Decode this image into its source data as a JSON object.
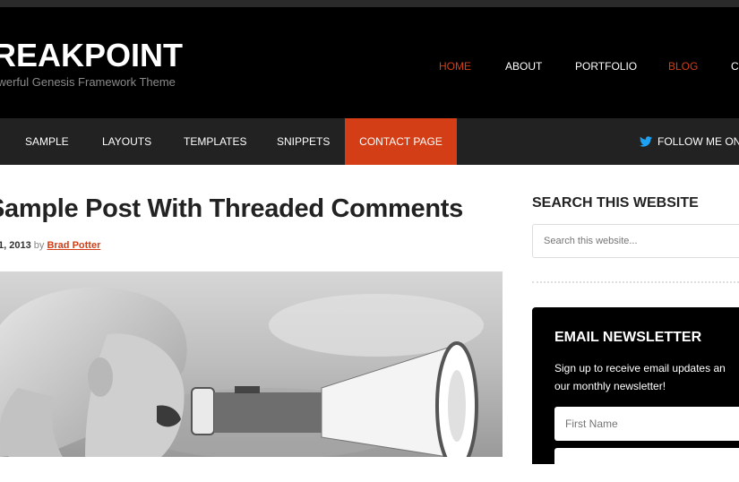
{
  "header": {
    "site_title": "BREAKPOINT",
    "tagline": "A Powerful Genesis Framework Theme",
    "nav": [
      {
        "label": "HOME",
        "active": true
      },
      {
        "label": "ABOUT",
        "active": false
      },
      {
        "label": "PORTFOLIO",
        "active": false
      },
      {
        "label": "BLOG",
        "active": true
      },
      {
        "label": "C",
        "active": false
      }
    ]
  },
  "subnav": {
    "items": [
      "SAMPLE",
      "LAYOUTS",
      "TEMPLATES",
      "SNIPPETS"
    ],
    "contact": "CONTACT PAGE",
    "follow": "FOLLOW ME ON"
  },
  "post": {
    "title": "Sample Post With Threaded Comments",
    "date": "1, 2013",
    "by": "by",
    "author": "Brad Potter"
  },
  "sidebar": {
    "search_title": "SEARCH THIS WEBSITE",
    "search_placeholder": "Search this website...",
    "newsletter_title": "EMAIL NEWSLETTER",
    "newsletter_line1": "Sign up to receive email updates an",
    "newsletter_line2": "our monthly newsletter!",
    "first_name_placeholder": "First Name"
  },
  "colors": {
    "accent": "#d33e16",
    "header_bg": "#000000",
    "subnav_bg": "#222222"
  }
}
